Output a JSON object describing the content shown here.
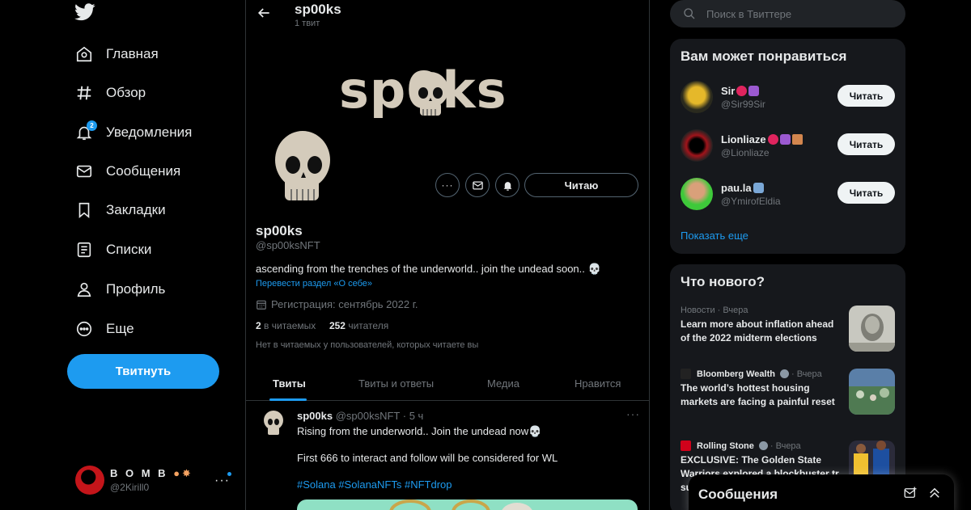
{
  "nav": {
    "items": [
      {
        "label": "Главная",
        "icon": "home-icon"
      },
      {
        "label": "Обзор",
        "icon": "hashtag-icon"
      },
      {
        "label": "Уведомления",
        "icon": "bell-icon",
        "badge": "2"
      },
      {
        "label": "Сообщения",
        "icon": "mail-icon"
      },
      {
        "label": "Закладки",
        "icon": "bookmark-icon"
      },
      {
        "label": "Списки",
        "icon": "list-icon"
      },
      {
        "label": "Профиль",
        "icon": "person-icon"
      },
      {
        "label": "Еще",
        "icon": "more-circle-icon"
      }
    ],
    "tweet_button": "Твитнуть",
    "account": {
      "name": "B O M B",
      "handle": "@2Kirill0"
    }
  },
  "header": {
    "name": "sp00ks",
    "tweet_count": "1 твит"
  },
  "banner": {
    "text": "sp0ks"
  },
  "profile": {
    "follow_label": "Читаю",
    "name": "sp00ks",
    "handle": "@sp00ksNFT",
    "bio": "ascending from the trenches of the underworld.. join the undead soon..",
    "translate": "Перевести раздел «О себе»",
    "joined": "Регистрация: сентябрь 2022 г.",
    "following_count": "2",
    "following_label": "в читаемых",
    "followers_count": "252",
    "followers_label": "читателя",
    "followed_by": "Нет в читаемых у пользователей, которых читаете вы"
  },
  "tabs": [
    "Твиты",
    "Твиты и ответы",
    "Медиа",
    "Нравится"
  ],
  "tweet": {
    "name": "sp00ks",
    "handle": "@sp00ksNFT",
    "time": "· 5 ч",
    "line1": "Rising from the underworld.. Join the undead now",
    "line2": "First 666 to interact and follow will be considered for WL",
    "tags": "#Solana #SolanaNFTs #NFTdrop"
  },
  "search": {
    "placeholder": "Поиск в Твиттере"
  },
  "suggestions": {
    "title": "Вам может понравиться",
    "follow_label": "Читать",
    "show_more": "Показать еще",
    "items": [
      {
        "name": "Sir",
        "handle": "@Sir99Sir"
      },
      {
        "name": "Lionliaze",
        "handle": "@Lionliaze"
      },
      {
        "name": "pau.la",
        "handle": "@YmirofEldia"
      }
    ]
  },
  "trends": {
    "title": "Что нового?",
    "items": [
      {
        "source": "Новости",
        "time": "· Вчера",
        "title": "Learn more about inflation ahead of the 2022 midterm elections"
      },
      {
        "source": "Bloomberg Wealth",
        "time": "· Вчера",
        "title": "The world’s hottest housing markets are facing a painful reset"
      },
      {
        "source": "Rolling Stone",
        "time": "· Вчера",
        "title": "EXCLUSIVE: The Golden State Warriors explored a blockbuster tr su"
      }
    ]
  },
  "messages": {
    "title": "Сообщения"
  },
  "colors": {
    "accent": "#1d9bf0",
    "background": "#000000",
    "panel": "#16181c",
    "muted": "#71767b"
  }
}
